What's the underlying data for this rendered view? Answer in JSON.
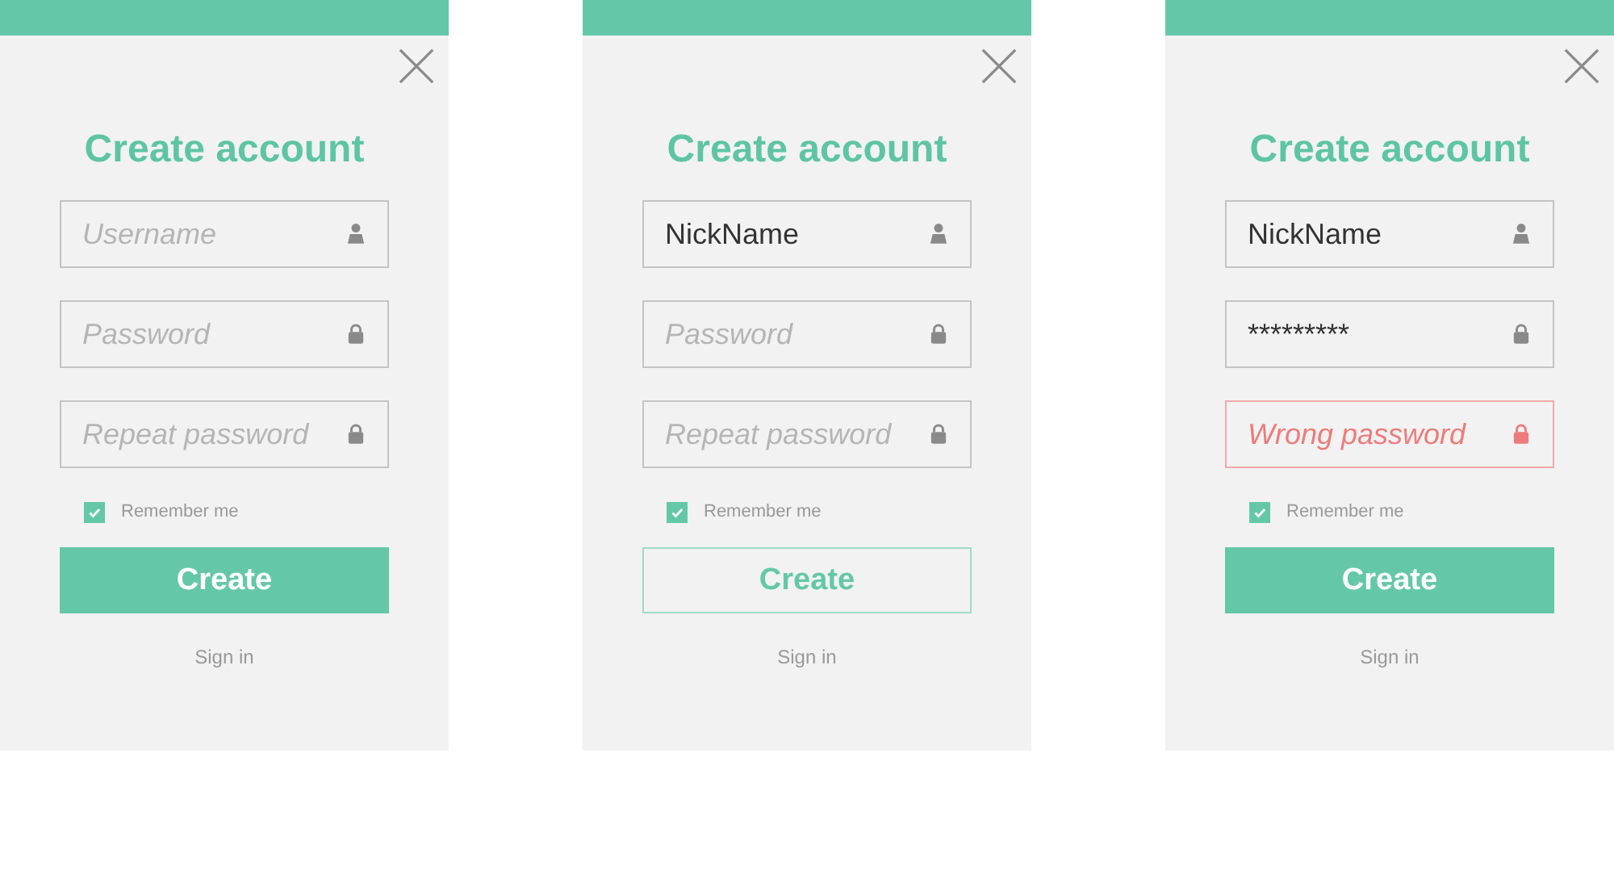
{
  "panels": [
    {
      "title": "Create account",
      "fields": [
        {
          "kind": "user",
          "placeholder": "Username",
          "error": false
        },
        {
          "kind": "lock",
          "placeholder": "Password",
          "error": false
        },
        {
          "kind": "lock",
          "placeholder": "Repeat password",
          "error": false
        }
      ],
      "remember": {
        "label": "Remember me",
        "checked": true
      },
      "button": {
        "label": "Create",
        "kind": "filled"
      },
      "link": "Sign in"
    },
    {
      "title": "Create account",
      "fields": [
        {
          "kind": "user",
          "value": "NickName",
          "error": false
        },
        {
          "kind": "lock",
          "placeholder": "Password",
          "error": false
        },
        {
          "kind": "lock",
          "placeholder": "Repeat password",
          "error": false
        }
      ],
      "remember": {
        "label": "Remember me",
        "checked": true
      },
      "button": {
        "label": "Create",
        "kind": "outline"
      },
      "link": "Sign in"
    },
    {
      "title": "Create account",
      "fields": [
        {
          "kind": "user",
          "value": "NickName",
          "error": false
        },
        {
          "kind": "lock",
          "value": "*********",
          "error": false
        },
        {
          "kind": "lock",
          "placeholder": "Wrong password",
          "error": true
        }
      ],
      "remember": {
        "label": "Remember me",
        "checked": true
      },
      "button": {
        "label": "Create",
        "kind": "filled"
      },
      "link": "Sign in"
    }
  ]
}
